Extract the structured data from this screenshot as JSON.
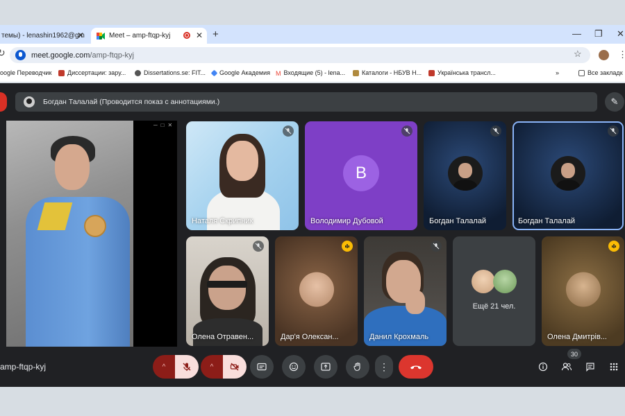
{
  "browser": {
    "tabs": [
      {
        "title": "темы) - lenashin1962@gm"
      },
      {
        "title": "Meet – amp-ftqp-kyj"
      }
    ],
    "new_tab_label": "+",
    "url_host": "meet.google.com",
    "url_path": "/amp-ftqp-kyj",
    "bookmarks": [
      {
        "label": "oogle Переводчик",
        "icon_color": "#4285f4"
      },
      {
        "label": "Диссертации: зару...",
        "icon_color": "#c0392b"
      },
      {
        "label": "Dissertations.se: FIT...",
        "icon_color": "#555555"
      },
      {
        "label": "Google Академия",
        "icon_color": "#4285f4"
      },
      {
        "label": "Входящие (5) - lena...",
        "icon_color": "#ea4335"
      },
      {
        "label": "Каталоги - НБУВ Н...",
        "icon_color": "#b08a3e"
      },
      {
        "label": "Українська трансл...",
        "icon_color": "#c0392b"
      }
    ],
    "all_bookmarks_label": "Все закладк"
  },
  "meet": {
    "presenter_bar_text": "Богдан Талалай (Проводится показ с аннотациями.)",
    "tiles": [
      {
        "name": "Наталя Скрипник",
        "mic": "muted"
      },
      {
        "name": "Володимир Дубовой",
        "avatar_letter": "В",
        "mic": "muted"
      },
      {
        "name": "Богдан Талалай",
        "mic": "muted"
      },
      {
        "name": "Богдан Талалай",
        "mic": "muted",
        "selected": true
      },
      {
        "name": "Олена Отравен...",
        "mic": "muted"
      },
      {
        "name": "Дар'я Олексан...",
        "mic": "active"
      },
      {
        "name": "Данил Крохмаль",
        "mic": "muted"
      },
      {
        "name": "",
        "more_label": "Ещё 21 чел."
      },
      {
        "name": "Олена Дмитрів...",
        "mic": "active"
      }
    ],
    "meeting_code": "amp-ftqp-kyj",
    "participants_count": "30",
    "colors": {
      "background": "#202124",
      "surface": "#3c4043",
      "danger": "#dc362e",
      "accent": "#8ab4f8"
    },
    "controls": [
      "mic-off-icon",
      "camera-off-icon",
      "captions-icon",
      "emoji-icon",
      "present-icon",
      "raise-hand-icon",
      "more-icon",
      "hangup-icon"
    ],
    "right_controls": [
      "info-icon",
      "people-icon",
      "chat-icon",
      "apps-icon"
    ]
  }
}
